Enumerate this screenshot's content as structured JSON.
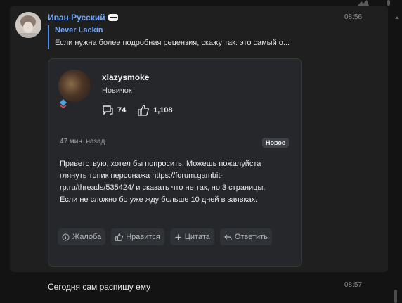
{
  "message": {
    "author": "Иван Русский",
    "time": "08:56",
    "reply": {
      "author": "Never Lackin",
      "text": "Если нужна более подробная рецензия, скажу так: это самый о..."
    },
    "card": {
      "username": "xlazysmoke",
      "rank": "Новичок",
      "messages_count": "74",
      "likes_count": "1,108",
      "posted": "47 мин. назад",
      "badge": "Новое",
      "body": "Приветствую, хотел бы попросить. Можешь пожалуйста глянуть топик персонажа https://forum.gambit-rp.ru/threads/535424/ и сказать что не так, но 3 страницы. Если не сложно бо уже жду больше 10 дней в заявках.",
      "actions": {
        "report": "Жалоба",
        "like": "Нравится",
        "quote": "Цитата",
        "reply": "Ответить"
      }
    }
  },
  "followup": {
    "text": "Сегодня сам распишу ему",
    "time": "08:57"
  },
  "colors": {
    "accent": "#6fa8ff",
    "background": "#131313",
    "group_bg": "#1f1f1f",
    "card_bg": "#25272b"
  }
}
